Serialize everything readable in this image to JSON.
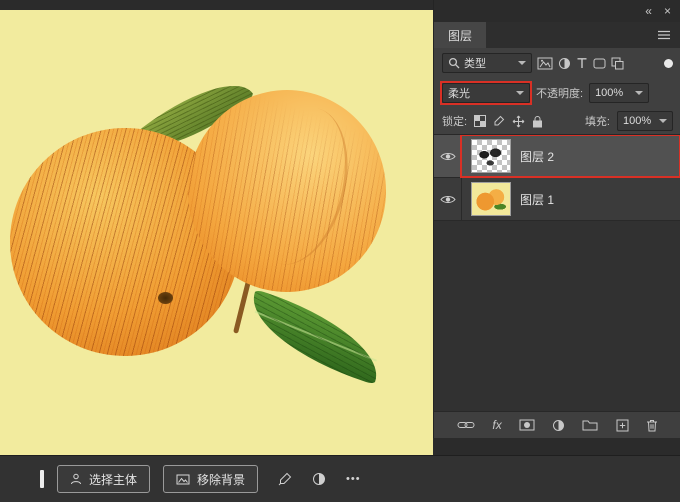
{
  "window": {
    "collapse": "«",
    "close": "×"
  },
  "panel": {
    "tab": "图层",
    "filter": {
      "label": "类型"
    },
    "blend": {
      "value": "柔光"
    },
    "opacity": {
      "label": "不透明度:",
      "value": "100%"
    },
    "lock": {
      "label": "锁定:"
    },
    "fill": {
      "label": "填充:",
      "value": "100%"
    },
    "layers": [
      {
        "name": "图层 2",
        "selected": true
      },
      {
        "name": "图层 1",
        "selected": false
      }
    ],
    "footer": {
      "fx_label": "fx"
    }
  },
  "taskbar": {
    "select_subject": "选择主体",
    "remove_background": "移除背景",
    "more": "•••"
  },
  "colors": {
    "canvas_bg": "#f2eb9e",
    "highlight_red": "#d93025",
    "panel_bg": "#404040",
    "selected_layer_bg": "#515151"
  }
}
